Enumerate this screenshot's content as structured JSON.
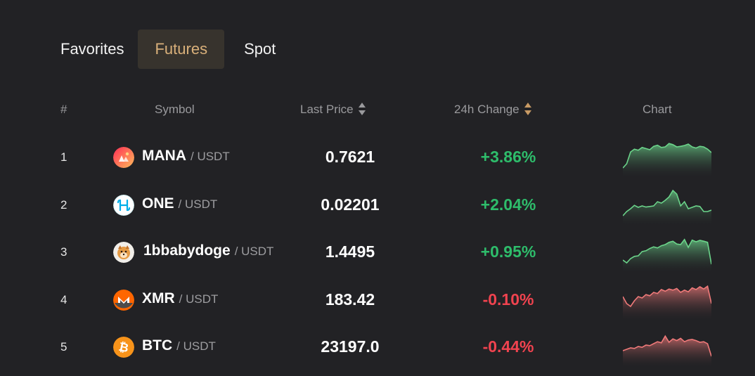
{
  "tabs": [
    {
      "label": "Favorites",
      "active": false
    },
    {
      "label": "Futures",
      "active": true
    },
    {
      "label": "Spot",
      "active": false
    }
  ],
  "columns": {
    "index": "#",
    "symbol": "Symbol",
    "last_price": "Last Price",
    "change": "24h Change",
    "chart": "Chart"
  },
  "colors": {
    "up": "#2ebd6b",
    "down": "#f0434f",
    "accent": "#d9b07a",
    "spark_up": "#6bd48a",
    "spark_down": "#f07a7a"
  },
  "rows": [
    {
      "index": "1",
      "symbol": "MANA",
      "quote": "/ USDT",
      "price": "0.7621",
      "change": "+3.86%",
      "direction": "up",
      "icon": "mana-logo-icon",
      "spark": [
        0.05,
        0.2,
        0.62,
        0.72,
        0.68,
        0.78,
        0.74,
        0.7,
        0.82,
        0.86,
        0.78,
        0.8,
        0.92,
        0.88,
        0.8,
        0.82,
        0.85,
        0.9,
        0.8,
        0.76,
        0.82,
        0.8,
        0.72,
        0.6
      ]
    },
    {
      "index": "2",
      "symbol": "ONE",
      "quote": "/ USDT",
      "price": "0.02201",
      "change": "+2.04%",
      "direction": "up",
      "icon": "harmony-one-logo-icon",
      "spark": [
        0.05,
        0.2,
        0.3,
        0.42,
        0.35,
        0.4,
        0.36,
        0.38,
        0.4,
        0.55,
        0.5,
        0.6,
        0.72,
        0.95,
        0.82,
        0.4,
        0.55,
        0.3,
        0.35,
        0.4,
        0.38,
        0.2,
        0.2,
        0.25
      ]
    },
    {
      "index": "3",
      "symbol": "1bbabydoge",
      "quote": "/ USDT",
      "price": "1.4495",
      "change": "+0.95%",
      "direction": "up",
      "icon": "babydoge-logo-icon",
      "spark": [
        0.15,
        0.05,
        0.2,
        0.28,
        0.3,
        0.45,
        0.48,
        0.56,
        0.62,
        0.58,
        0.66,
        0.7,
        0.78,
        0.82,
        0.72,
        0.7,
        0.88,
        0.6,
        0.86,
        0.8,
        0.85,
        0.82,
        0.78,
        0.0
      ]
    },
    {
      "index": "4",
      "symbol": "XMR",
      "quote": "/ USDT",
      "price": "183.42",
      "change": "-0.10%",
      "direction": "down",
      "icon": "monero-logo-icon",
      "spark": [
        0.55,
        0.3,
        0.2,
        0.4,
        0.55,
        0.5,
        0.62,
        0.58,
        0.7,
        0.66,
        0.8,
        0.74,
        0.82,
        0.78,
        0.84,
        0.7,
        0.78,
        0.72,
        0.86,
        0.8,
        0.9,
        0.82,
        0.92,
        0.3
      ]
    },
    {
      "index": "5",
      "symbol": "BTC",
      "quote": "/ USDT",
      "price": "23197.0",
      "change": "-0.44%",
      "direction": "down",
      "icon": "bitcoin-logo-icon",
      "spark": [
        0.3,
        0.35,
        0.4,
        0.38,
        0.45,
        0.42,
        0.5,
        0.48,
        0.55,
        0.62,
        0.58,
        0.82,
        0.6,
        0.72,
        0.66,
        0.74,
        0.62,
        0.68,
        0.7,
        0.66,
        0.6,
        0.62,
        0.55,
        0.1
      ]
    }
  ]
}
